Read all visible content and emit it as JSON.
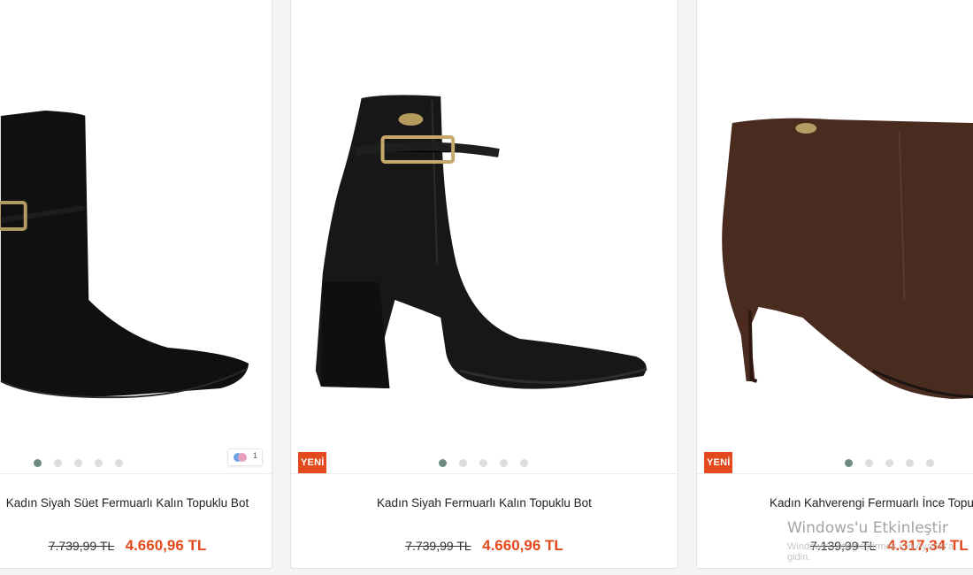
{
  "products": [
    {
      "title": "Kadın Siyah Süet Fermuarlı Kalın Topuklu Bot",
      "old_price": "7.739,99 TL",
      "new_price": "4.660,96 TL",
      "badge": "",
      "color_count": "1",
      "image_colors": [
        "#111111"
      ]
    },
    {
      "title": "Kadın Siyah Fermuarlı Kalın Topuklu Bot",
      "old_price": "7.739,99 TL",
      "new_price": "4.660,96 TL",
      "badge": "YENİ",
      "image_colors": [
        "#141414"
      ]
    },
    {
      "title": "Kadın Kahverengi Fermuarlı İnce Topuklu Bot",
      "old_price": "7.139,99 TL",
      "new_price": "4.317,34 TL",
      "badge": "YENİ",
      "image_colors": [
        "#4a2a1e"
      ]
    }
  ],
  "carousel": {
    "dot_count": 5,
    "active_index": 0
  },
  "watermark": {
    "title": "Windows'u Etkinleştir",
    "subtitle": "Windows'u etkinleştirmek için Ayarlar'a gidin."
  },
  "colors": {
    "accent": "#e2491c",
    "dot_active": "#6d8b83",
    "dot_inactive": "#dddddd"
  }
}
